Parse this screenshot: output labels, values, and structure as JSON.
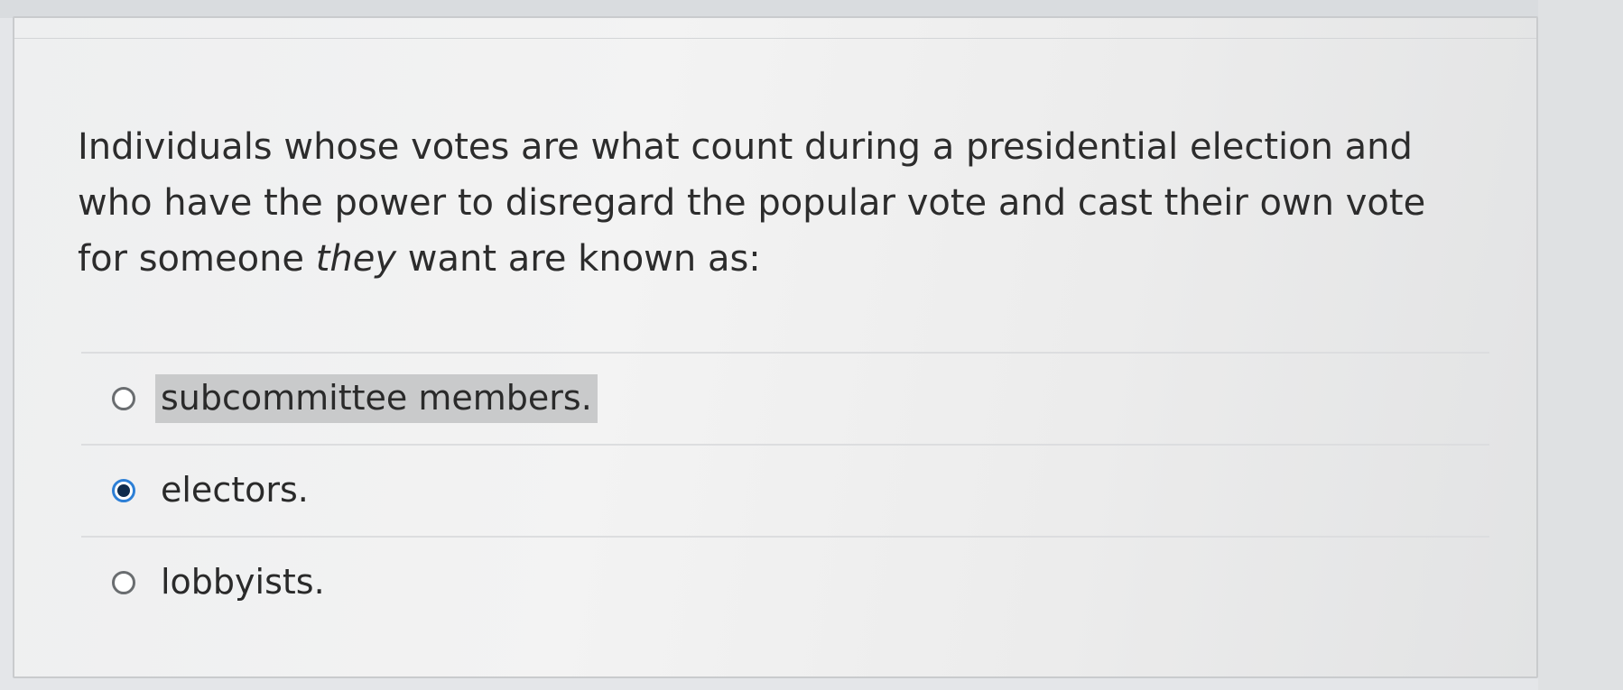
{
  "question": {
    "text_before_em": "Individuals whose votes are what count during a presidential election and who have the power to disregard the popular vote and cast their own vote for someone ",
    "emphasis": "they",
    "text_after_em": " want are known as:"
  },
  "answers": [
    {
      "label": "subcommittee members.",
      "selected": false,
      "highlighted": true
    },
    {
      "label": "electors.",
      "selected": true,
      "highlighted": false
    },
    {
      "label": "lobbyists.",
      "selected": false,
      "highlighted": false
    }
  ],
  "colors": {
    "selected_radio_ring": "#2d7fd6",
    "selected_radio_dot": "#0f2b4c",
    "highlight": "#c9cacb"
  }
}
